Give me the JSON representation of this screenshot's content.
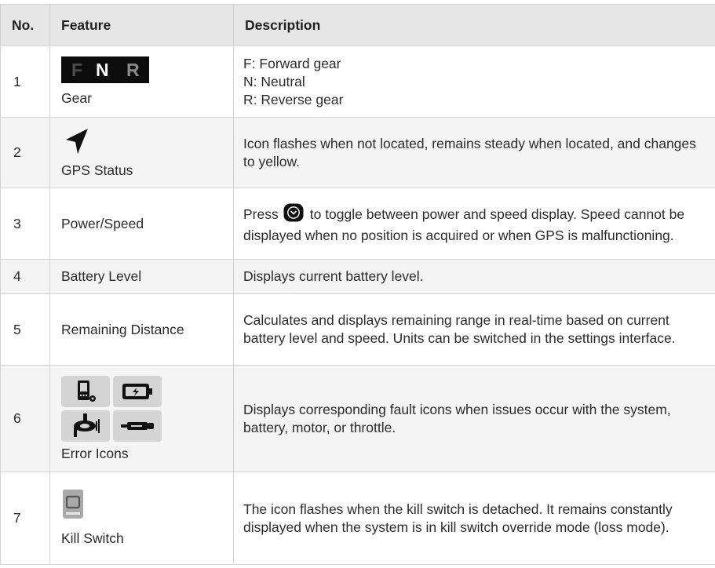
{
  "table": {
    "headers": {
      "no": "No.",
      "feature": "Feature",
      "description": "Description"
    },
    "rows": [
      {
        "no": "1",
        "feature": "Gear",
        "gear_letters": [
          "F",
          "N",
          "R"
        ],
        "description_lines": [
          "F: Forward gear",
          "N: Neutral",
          "R: Reverse gear"
        ]
      },
      {
        "no": "2",
        "feature": "GPS Status",
        "icon": "gps-arrow-icon",
        "description": "Icon flashes when not located, remains steady when located, and changes to yellow."
      },
      {
        "no": "3",
        "feature": "Power/Speed",
        "icon": "chevron-down-button-icon",
        "description_before": "Press",
        "description_after": "to toggle between power and speed display. Speed cannot be displayed when no position is acquired or when GPS is malfunctioning."
      },
      {
        "no": "4",
        "feature": "Battery Level",
        "description": "Displays current battery level."
      },
      {
        "no": "5",
        "feature": "Remaining Distance",
        "description": "Calculates and displays remaining range in real-time based on current battery level and speed. Units can be switched in the settings interface."
      },
      {
        "no": "6",
        "feature": "Error Icons",
        "icons": [
          "system-error-icon",
          "battery-error-icon",
          "motor-error-icon",
          "throttle-error-icon"
        ],
        "description": "Displays corresponding fault icons when issues occur with the system, battery, motor, or throttle."
      },
      {
        "no": "7",
        "feature": "Kill Switch",
        "icon": "kill-switch-icon",
        "description": "The icon flashes when the kill switch is detached. It remains constantly displayed when the system is in kill switch override mode (loss mode)."
      }
    ]
  },
  "colors": {
    "header_bg": "#e6e6e6",
    "shaded_row_bg": "#f4f4f4",
    "border": "#d3d3d3",
    "text": "#2b2b2b"
  }
}
